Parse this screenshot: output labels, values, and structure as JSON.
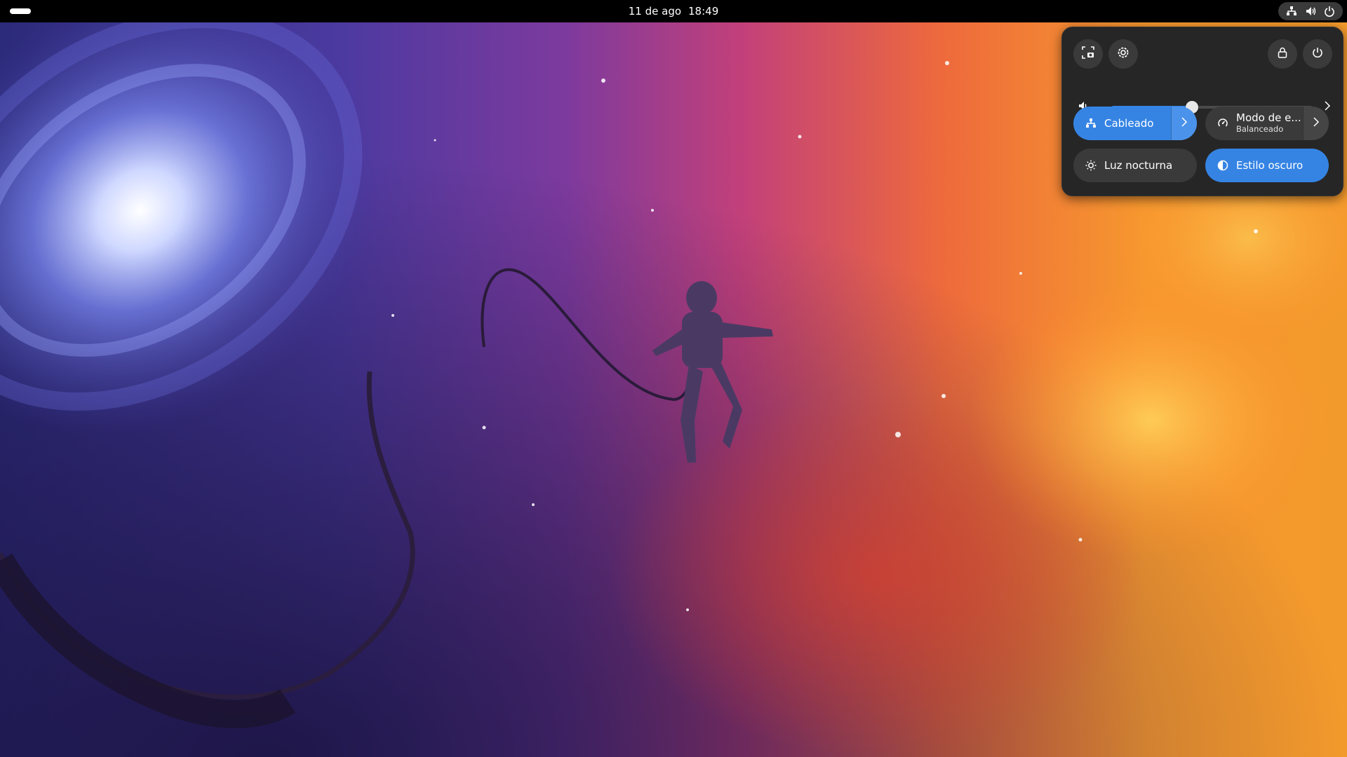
{
  "topbar": {
    "date": "11 de ago",
    "time": "18:49",
    "status_icons": [
      "network-wired-icon",
      "volume-icon",
      "power-icon"
    ]
  },
  "quick_settings": {
    "volume_level": 0.4,
    "toggles": {
      "wired": {
        "label": "Cableado",
        "active": true
      },
      "power_mode": {
        "label": "Modo de e...",
        "subtitle": "Balanceado",
        "active": false
      },
      "night_light": {
        "label": "Luz nocturna",
        "active": false
      },
      "dark_style": {
        "label": "Estilo oscuro",
        "active": true
      }
    }
  },
  "colors": {
    "accent": "#3584e4",
    "panel_bg": "#262626",
    "button_bg": "#3a3a3a"
  }
}
